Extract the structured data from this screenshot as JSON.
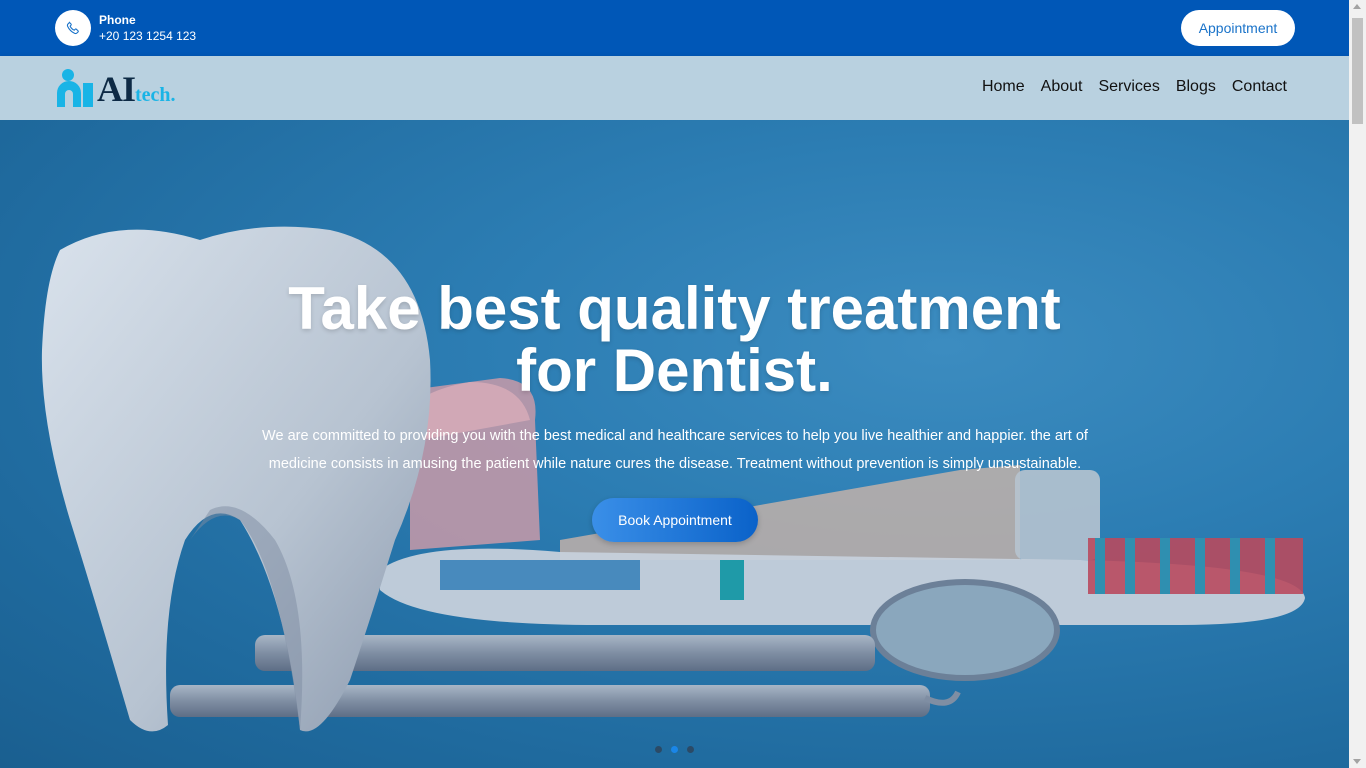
{
  "topbar": {
    "phone_label": "Phone",
    "phone_number": "+20 123 1254 123",
    "phone_icon": "phone-icon",
    "appointment_label": "Appointment"
  },
  "navbar": {
    "logo_text": "AI",
    "logo_sub": "tech.",
    "items": [
      {
        "label": "Home"
      },
      {
        "label": "About"
      },
      {
        "label": "Services"
      },
      {
        "label": "Blogs"
      },
      {
        "label": "Contact"
      }
    ]
  },
  "hero": {
    "title_line1": "Take best quality treatment",
    "title_line2": "for Dentist.",
    "text": "We are committed to providing you with the best medical and healthcare services to help you live healthier and happier. the art of medicine consists in amusing the patient while nature cures the disease. Treatment without prevention is simply unsustainable.",
    "button_label": "Book Appointment",
    "slides": 3,
    "active_slide": 2
  },
  "colors": {
    "topbar_bg": "#0057b7",
    "navbar_bg": "#b9d1e0",
    "accent": "#1a73c9",
    "logo_dark": "#0d2a45",
    "logo_light": "#19b4e6"
  }
}
